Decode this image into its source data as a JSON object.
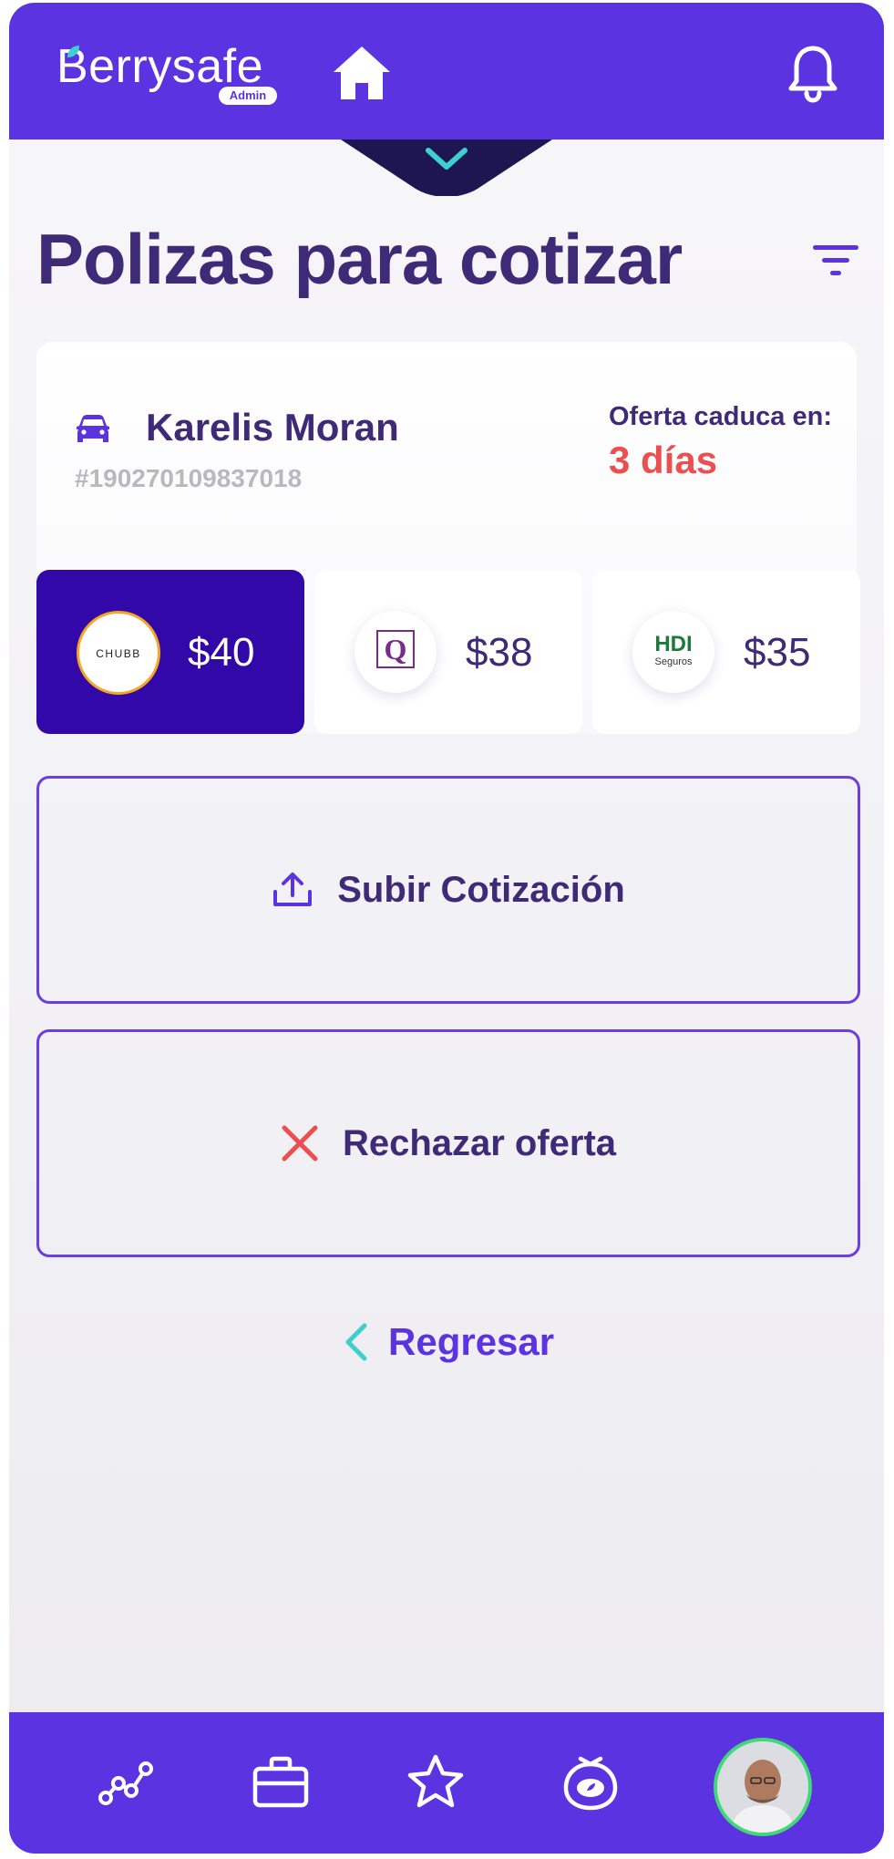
{
  "header": {
    "logo_text": "Berrysafe",
    "admin_badge": "Admin"
  },
  "page": {
    "title": "Polizas para cotizar"
  },
  "policy_card": {
    "client_name": "Karelis Moran",
    "policy_id": "#190270109837018",
    "expire_label": "Oferta caduca en:",
    "expire_value": "3 días"
  },
  "quotes": [
    {
      "insurer": "CHUBB",
      "price": "$40",
      "selected": true
    },
    {
      "insurer": "Qualitas",
      "price": "$38",
      "selected": false
    },
    {
      "insurer": "HDI Seguros",
      "price": "$35",
      "selected": false
    }
  ],
  "insurer_logo_text": {
    "chubb": "CHUBB",
    "qualitas": "Q",
    "hdi_top": "HDI",
    "hdi_bottom": "Seguros"
  },
  "actions": {
    "upload_label": "Subir Cotización",
    "reject_label": "Rechazar oferta",
    "back_label": "Regresar"
  },
  "bottom_nav": {
    "items": [
      "stats-icon",
      "briefcase-icon",
      "star-icon",
      "berry-icon",
      "avatar"
    ]
  },
  "colors": {
    "brand": "#5c33e0",
    "brand_dark": "#3308a8",
    "title": "#3f2a78",
    "accent_teal": "#3ecfcf",
    "danger": "#ec4f4f"
  }
}
